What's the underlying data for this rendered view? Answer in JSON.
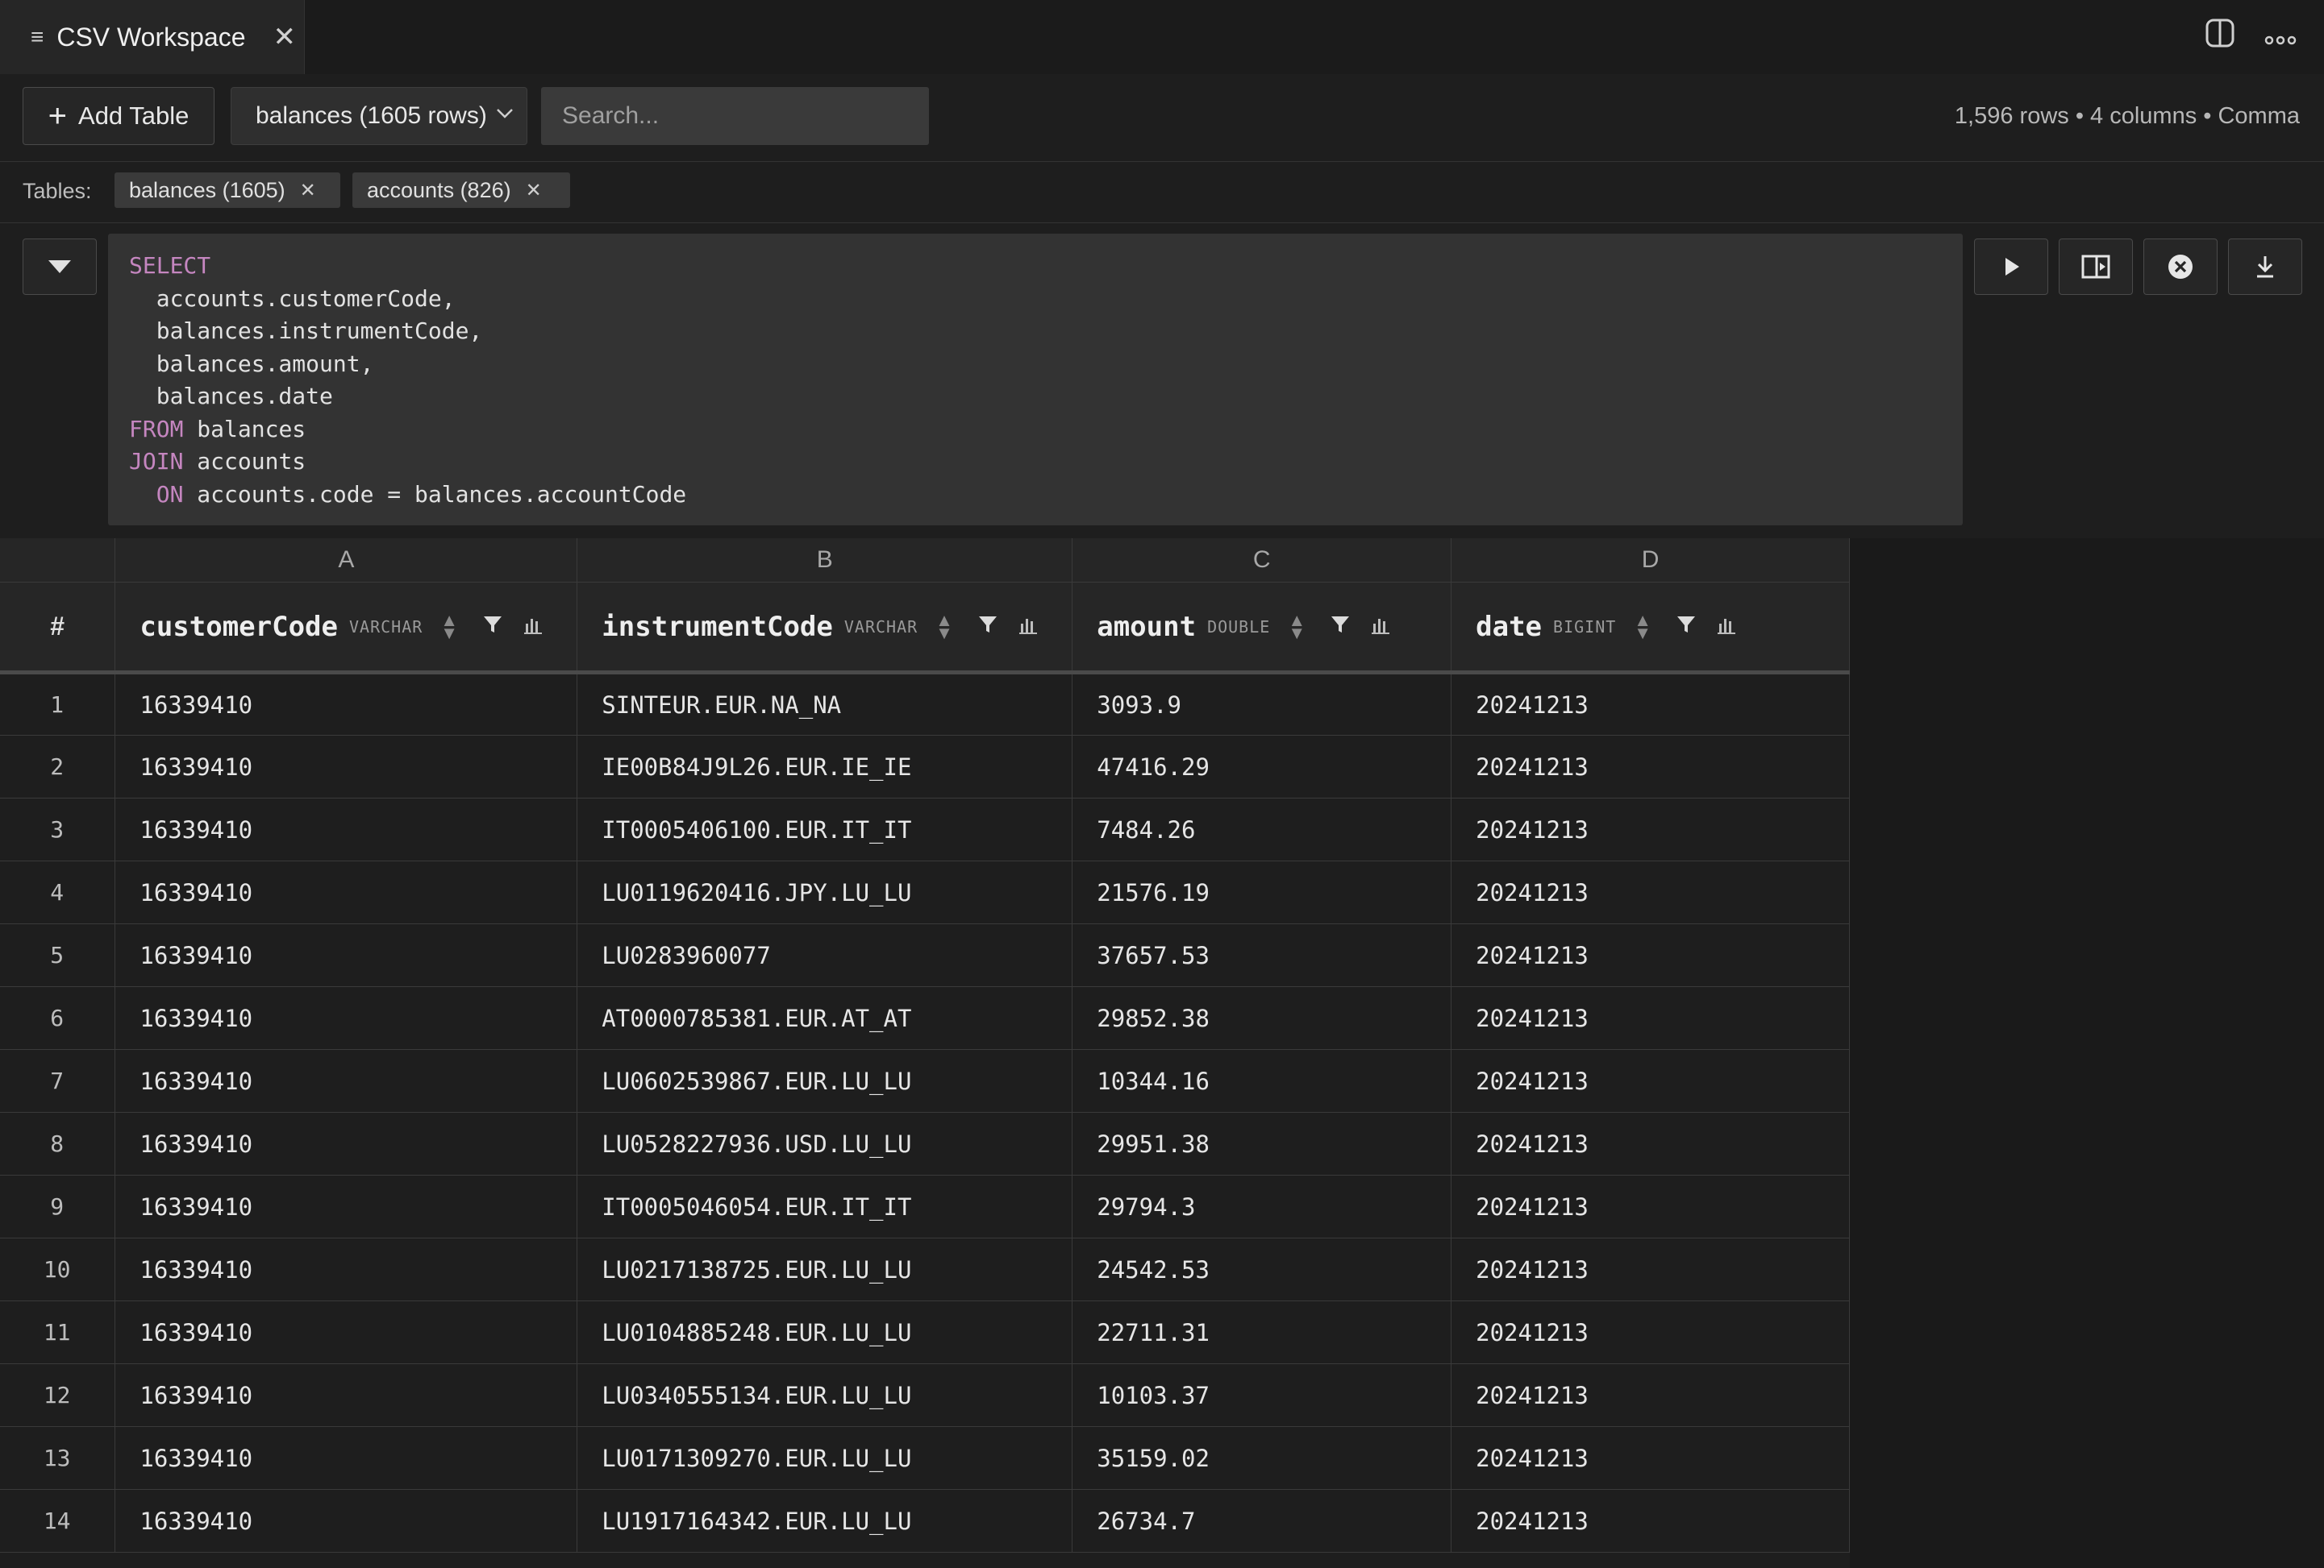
{
  "tab": {
    "title": "CSV Workspace",
    "close": "✕"
  },
  "toolbar": {
    "add_table_label": "Add Table",
    "table_select": "balances (1605 rows)",
    "search_placeholder": "Search...",
    "stats": "1,596 rows • 4 columns • Comma"
  },
  "tables_bar": {
    "label": "Tables:",
    "chips": [
      {
        "label": "balances (1605)"
      },
      {
        "label": "accounts (826)"
      }
    ]
  },
  "sql": {
    "lines": [
      {
        "kw": "SELECT",
        "rest": ""
      },
      {
        "kw": "",
        "rest": "  accounts.customerCode,"
      },
      {
        "kw": "",
        "rest": "  balances.instrumentCode,"
      },
      {
        "kw": "",
        "rest": "  balances.amount,"
      },
      {
        "kw": "",
        "rest": "  balances.date"
      },
      {
        "kw": "FROM",
        "rest": " balances"
      },
      {
        "kw": "JOIN",
        "rest": " accounts"
      },
      {
        "kw": "  ON",
        "rest": " accounts.code = balances.accountCode"
      }
    ]
  },
  "grid": {
    "index_header": "#",
    "column_letters": [
      "A",
      "B",
      "C",
      "D"
    ],
    "columns": [
      {
        "name": "customerCode",
        "type": "VARCHAR"
      },
      {
        "name": "instrumentCode",
        "type": "VARCHAR"
      },
      {
        "name": "amount",
        "type": "DOUBLE"
      },
      {
        "name": "date",
        "type": "BIGINT"
      }
    ],
    "rows": [
      [
        "1",
        "16339410",
        "SINTEUR.EUR.NA_NA",
        "3093.9",
        "20241213"
      ],
      [
        "2",
        "16339410",
        "IE00B84J9L26.EUR.IE_IE",
        "47416.29",
        "20241213"
      ],
      [
        "3",
        "16339410",
        "IT0005406100.EUR.IT_IT",
        "7484.26",
        "20241213"
      ],
      [
        "4",
        "16339410",
        "LU0119620416.JPY.LU_LU",
        "21576.19",
        "20241213"
      ],
      [
        "5",
        "16339410",
        "LU0283960077",
        "37657.53",
        "20241213"
      ],
      [
        "6",
        "16339410",
        "AT0000785381.EUR.AT_AT",
        "29852.38",
        "20241213"
      ],
      [
        "7",
        "16339410",
        "LU0602539867.EUR.LU_LU",
        "10344.16",
        "20241213"
      ],
      [
        "8",
        "16339410",
        "LU0528227936.USD.LU_LU",
        "29951.38",
        "20241213"
      ],
      [
        "9",
        "16339410",
        "IT0005046054.EUR.IT_IT",
        "29794.3",
        "20241213"
      ],
      [
        "10",
        "16339410",
        "LU0217138725.EUR.LU_LU",
        "24542.53",
        "20241213"
      ],
      [
        "11",
        "16339410",
        "LU0104885248.EUR.LU_LU",
        "22711.31",
        "20241213"
      ],
      [
        "12",
        "16339410",
        "LU0340555134.EUR.LU_LU",
        "10103.37",
        "20241213"
      ],
      [
        "13",
        "16339410",
        "LU0171309270.EUR.LU_LU",
        "35159.02",
        "20241213"
      ],
      [
        "14",
        "16339410",
        "LU1917164342.EUR.LU_LU",
        "26734.7",
        "20241213"
      ]
    ]
  },
  "icons": {
    "tab": "menu-lines-icon",
    "split": "split-view-icon",
    "more": "more-dots-icon",
    "run": "play-icon",
    "layout": "layout-panel-icon",
    "clear": "clear-circle-icon",
    "download": "download-icon",
    "filter": "filter-icon",
    "stats": "bar-chart-icon",
    "sort": "sort-arrows-icon"
  },
  "colors": {
    "keyword": "#c586c0",
    "background": "#1e1e1e"
  }
}
